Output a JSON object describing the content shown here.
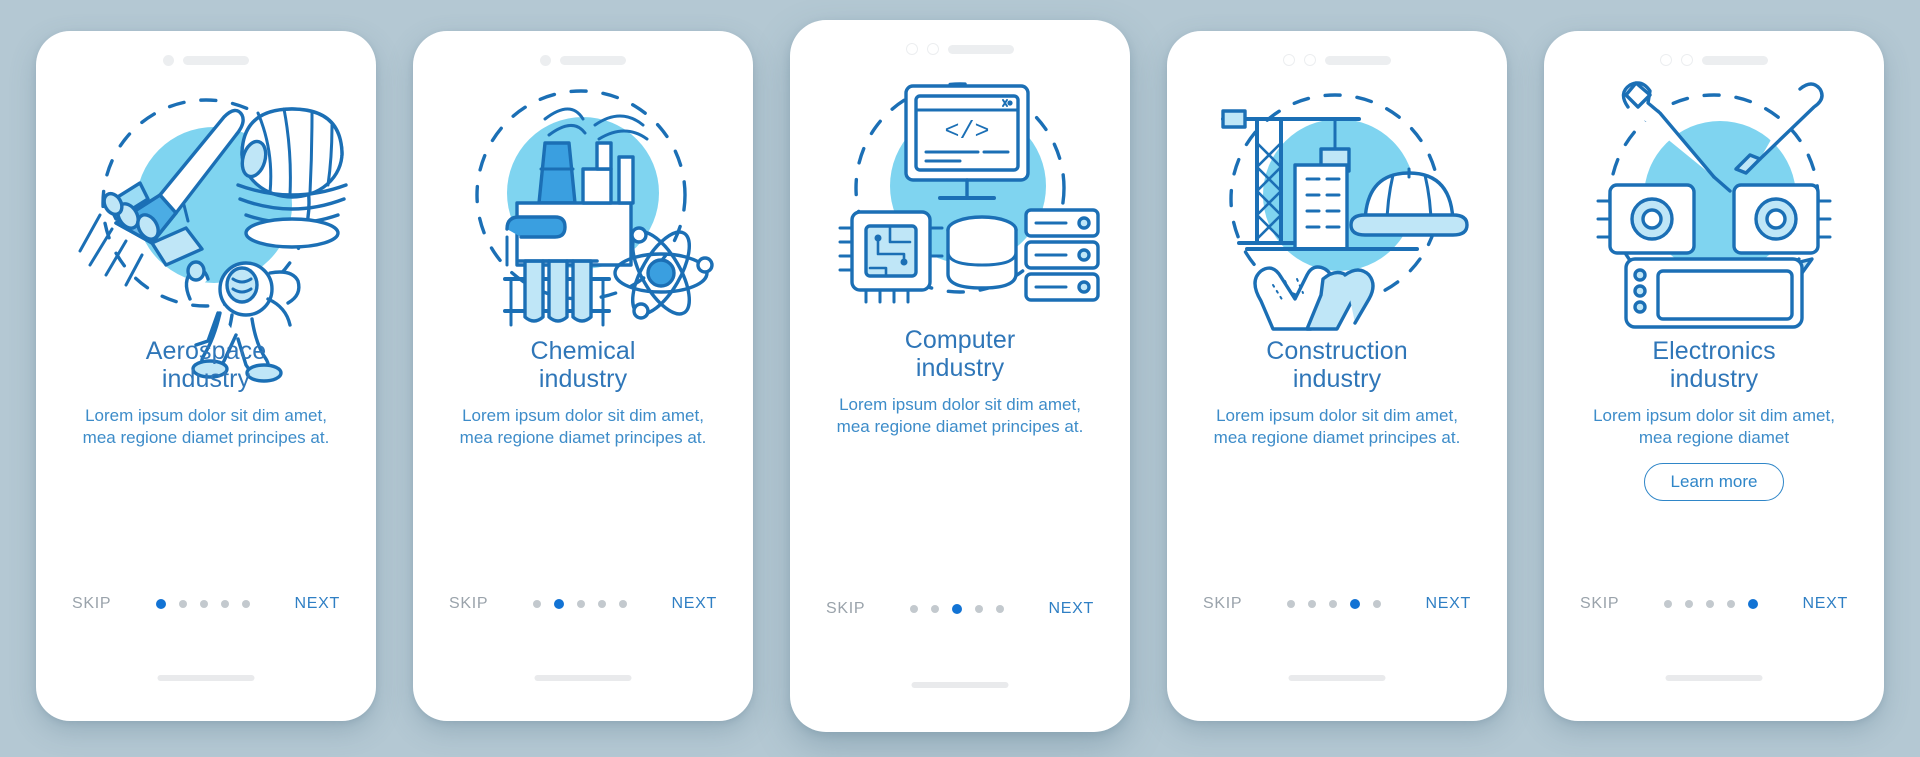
{
  "theme": {
    "background": "#b4c8d3",
    "card_background": "#ffffff",
    "title_color": "#2f76b8",
    "body_color": "#3d8cc9",
    "accent_stroke": "#1b6fb5",
    "accent_light": "#7fd4f0",
    "accent_mid": "#3a9fe0",
    "skip_color": "#9aa3ab",
    "next_color": "#2f7fc4",
    "dot_inactive": "#c3c9ce",
    "dot_active": "#1273d4"
  },
  "shared": {
    "skip_label": "SKIP",
    "next_label": "NEXT",
    "description": "Lorem ipsum dolor sit dim amet, mea regione diamet principes at.",
    "description_short": "Lorem ipsum dolor sit dim amet, mea regione diamet",
    "total_dots": 5
  },
  "screens": [
    {
      "index": 1,
      "illustration": "aerospace-illustration",
      "title": "Aerospace\nindustry",
      "description": "Lorem ipsum dolor sit dim amet, mea regione diamet principes at.",
      "active_dot": 1,
      "skip_label": "SKIP",
      "next_label": "NEXT",
      "has_learn_more": false,
      "learn_more_label": ""
    },
    {
      "index": 2,
      "illustration": "chemical-illustration",
      "title": "Chemical\nindustry",
      "description": "Lorem ipsum dolor sit dim amet, mea regione diamet principes at.",
      "active_dot": 2,
      "skip_label": "SKIP",
      "next_label": "NEXT",
      "has_learn_more": false,
      "learn_more_label": ""
    },
    {
      "index": 3,
      "illustration": "computer-illustration",
      "title": "Computer\nindustry",
      "description": "Lorem ipsum dolor sit dim amet, mea regione diamet principes at.",
      "active_dot": 3,
      "skip_label": "SKIP",
      "next_label": "NEXT",
      "has_learn_more": false,
      "learn_more_label": ""
    },
    {
      "index": 4,
      "illustration": "construction-illustration",
      "title": "Construction\nindustry",
      "description": "Lorem ipsum dolor sit dim amet, mea regione diamet principes at.",
      "active_dot": 4,
      "skip_label": "SKIP",
      "next_label": "NEXT",
      "has_learn_more": false,
      "learn_more_label": ""
    },
    {
      "index": 5,
      "illustration": "electronics-illustration",
      "title": "Electronics\nindustry",
      "description": "Lorem ipsum dolor sit dim amet, mea regione diamet",
      "active_dot": 5,
      "skip_label": "SKIP",
      "next_label": "NEXT",
      "has_learn_more": true,
      "learn_more_label": "Learn more"
    }
  ]
}
